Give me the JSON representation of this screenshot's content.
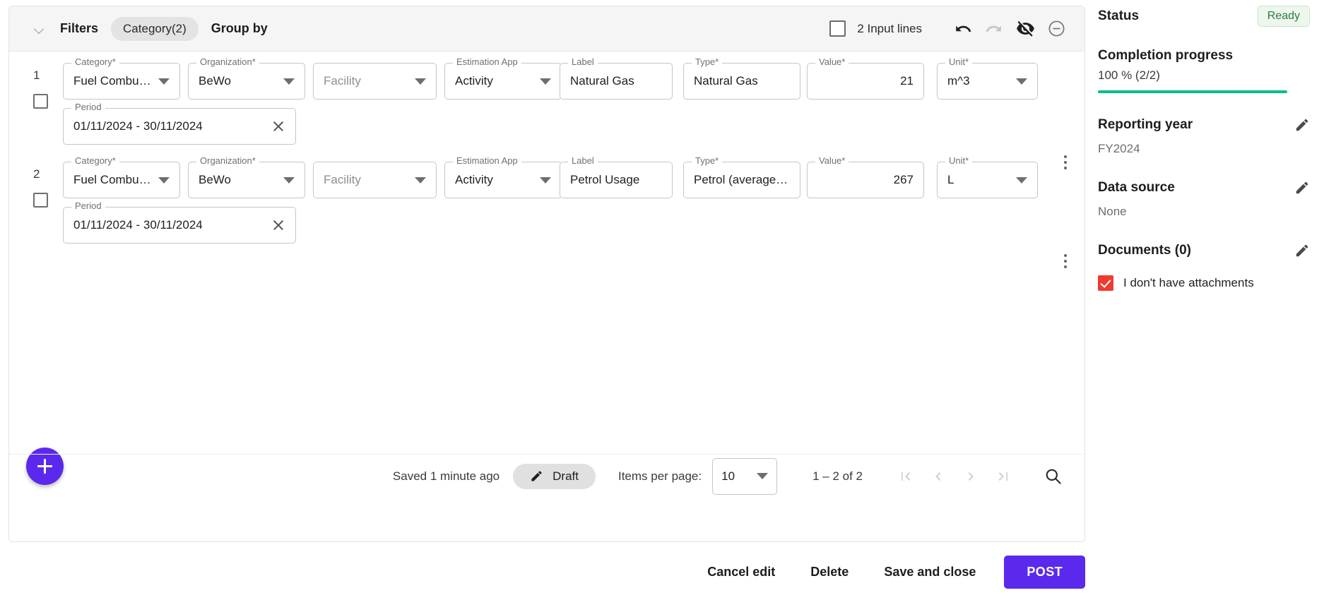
{
  "toolbar": {
    "filters_label": "Filters",
    "category_chip": "Category(2)",
    "group_by_label": "Group by",
    "input_lines_label": "2 Input lines",
    "icons": {
      "collapse": "chevron-down-icon",
      "select_all": "select-all-checkbox",
      "undo": "undo-icon",
      "redo": "redo-icon",
      "hide": "eye-off-icon",
      "remove": "minus-circle-icon"
    }
  },
  "field_labels": {
    "category": "Category*",
    "organization": "Organization*",
    "facility": "Facility",
    "estimation_app": "Estimation App",
    "label": "Label",
    "type": "Type*",
    "value": "Value*",
    "unit": "Unit*",
    "period": "Period"
  },
  "rows": [
    {
      "number": "1",
      "category": "Fuel Combusti…",
      "organization": "BeWo",
      "facility_placeholder": "Facility",
      "estimation_app": "Activity",
      "label": "Natural Gas",
      "type": "Natural Gas",
      "value": "21",
      "unit": "m^3",
      "period": "01/11/2024 - 30/11/2024"
    },
    {
      "number": "2",
      "category": "Fuel Combusti…",
      "organization": "BeWo",
      "facility_placeholder": "Facility",
      "estimation_app": "Activity",
      "label": "Petrol Usage",
      "type": "Petrol (average bi…",
      "value": "267",
      "unit": "L",
      "period": "01/11/2024 - 30/11/2024"
    }
  ],
  "footer": {
    "saved_text": "Saved 1 minute ago",
    "draft_label": "Draft",
    "items_per_page_label": "Items per page:",
    "items_per_page_value": "10",
    "range_text": "1 – 2 of 2"
  },
  "actions": {
    "cancel": "Cancel edit",
    "delete": "Delete",
    "save_and_close": "Save and close",
    "post": "POST"
  },
  "sidebar": {
    "status_title": "Status",
    "status_badge": "Ready",
    "completion_title": "Completion progress",
    "completion_value": "100 % (2/2)",
    "completion_percent": 100,
    "reporting_year_title": "Reporting year",
    "reporting_year_value": "FY2024",
    "data_source_title": "Data source",
    "data_source_value": "None",
    "documents_title": "Documents (0)",
    "attachments_label": "I don't have attachments"
  },
  "colors": {
    "primary": "#5b29ee",
    "progress": "#0bbd8b",
    "badge_text": "#2a7d3f",
    "badge_bg": "#edf7ee",
    "checkbox_red": "#f03a2e"
  }
}
